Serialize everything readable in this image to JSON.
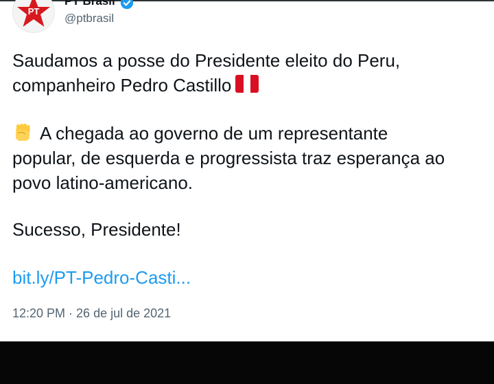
{
  "tweet": {
    "display_name": "PT Brasil",
    "handle": "@ptbrasil",
    "avatar_text": "PT",
    "line1": "Saudamos a posse do Presidente eleito do Peru,",
    "line2": "companheiro Pedro Castillo",
    "line3": "A chegada ao governo de um representante",
    "line4": "popular, de esquerda e progressista traz esperança ao",
    "line5": "povo latino-americano.",
    "line6": "Sucesso, Presidente!",
    "link": "bit.ly/PT-Pedro-Casti...",
    "timestamp": "12:20 PM · 26 de jul de 2021"
  },
  "colors": {
    "text": "#0f1419",
    "secondary": "#536471",
    "link": "#1d9bf0",
    "verified": "#1d9bf0",
    "pt_red": "#d7191f",
    "peru_red": "#d91023"
  },
  "icons": {
    "avatar": "pt-star-logo",
    "verified": "verified-badge-icon",
    "flag": "peru-flag-emoji",
    "fist": "raised-fist-emoji"
  }
}
